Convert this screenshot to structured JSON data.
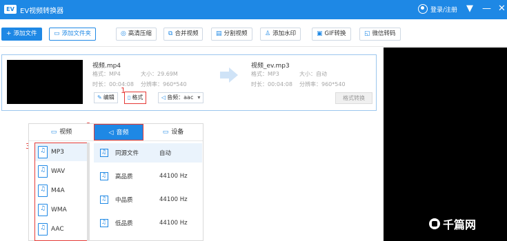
{
  "app": {
    "logo": "EV",
    "title": "EV视频转换器"
  },
  "titlebar": {
    "login_label": "登录/注册",
    "dropdown_icon": "▼",
    "minimize_icon": "—",
    "close_icon": "✕"
  },
  "toolbar": [
    {
      "label": "添加文件",
      "icon": "+"
    },
    {
      "label": "添加文件夹",
      "icon": "▭"
    },
    {
      "label": "高清压缩",
      "icon": "◎"
    },
    {
      "label": "合并视频",
      "icon": "⧉"
    },
    {
      "label": "分割视频",
      "icon": "▤"
    },
    {
      "label": "添加水印",
      "icon": "♙"
    },
    {
      "label": "GIF转换",
      "icon": "▣"
    },
    {
      "label": "微信转码",
      "icon": "◱"
    }
  ],
  "file": {
    "source": {
      "name": "视频.mp4",
      "format_label": "格式：MP4",
      "size_label": "大小：29.69M",
      "duration_label": "时长：00:04:08",
      "resolution_label": "分辨率：960*540"
    },
    "target": {
      "name": "视频_ev.mp3",
      "format_label": "格式：MP3",
      "size_label": "大小：自动",
      "duration_label": "时长：00:04:08",
      "resolution_label": "分辨率：960*540"
    },
    "edit_label": "编辑",
    "format_label": "格式",
    "audio_label": "音频：aac",
    "convert_label": "格式转换"
  },
  "annotations": {
    "step1": "1",
    "step2": "2",
    "step3": "3"
  },
  "panel": {
    "tabs": [
      {
        "label": "视频",
        "icon": "▭"
      },
      {
        "label": "音频",
        "icon": "◁"
      },
      {
        "label": "设备",
        "icon": "▭"
      }
    ],
    "formats": [
      "MP3",
      "WAV",
      "M4A",
      "WMA",
      "AAC"
    ],
    "qualities": [
      {
        "name": "同源文件",
        "rate": "自动"
      },
      {
        "name": "高品质",
        "rate": "44100 Hz"
      },
      {
        "name": "中品质",
        "rate": "44100 Hz"
      },
      {
        "name": "低品质",
        "rate": "44100 Hz"
      }
    ]
  },
  "watermark": {
    "text": "千篇网"
  },
  "colors": {
    "accent": "#1e88e5",
    "highlight": "#e53935",
    "preview_bg": "#000000"
  }
}
